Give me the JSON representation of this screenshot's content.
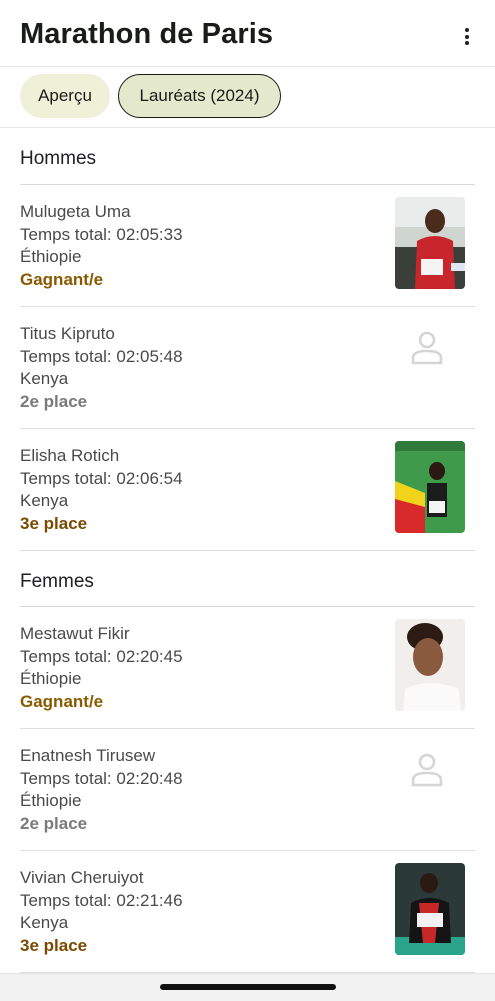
{
  "app": {
    "title": "Marathon de Paris"
  },
  "tabs": [
    {
      "label": "Aperçu",
      "selected": false
    },
    {
      "label": "Lauréats (2024)",
      "selected": true
    }
  ],
  "sections": [
    {
      "title": "Hommes",
      "entries": [
        {
          "name": "Mulugeta Uma",
          "time": "Temps total: 02:05:33",
          "country": "Éthiopie",
          "place": "Gagnant/e",
          "photo": "runner-photo"
        },
        {
          "name": "Titus Kipruto",
          "time": "Temps total: 02:05:48",
          "country": "Kenya",
          "place": "2e place",
          "photo": "person-placeholder-icon"
        },
        {
          "name": "Elisha Rotich",
          "time": "Temps total: 02:06:54",
          "country": "Kenya",
          "place": "3e place",
          "photo": "runner-photo"
        }
      ]
    },
    {
      "title": "Femmes",
      "entries": [
        {
          "name": "Mestawut Fikir",
          "time": "Temps total: 02:20:45",
          "country": "Éthiopie",
          "place": "Gagnant/e",
          "photo": "runner-photo"
        },
        {
          "name": "Enatnesh Tirusew",
          "time": "Temps total: 02:20:48",
          "country": "Éthiopie",
          "place": "2e place",
          "photo": "person-placeholder-icon"
        },
        {
          "name": "Vivian Cheruiyot",
          "time": "Temps total: 02:21:46",
          "country": "Kenya",
          "place": "3e place",
          "photo": "runner-photo"
        }
      ]
    }
  ],
  "colors": {
    "chip_bg": "#eef0d8",
    "chip_selected_bg": "#e4e8cc",
    "gold": "#8a5a00",
    "silver": "#7a7a7a",
    "bronze": "#7a4a00"
  }
}
